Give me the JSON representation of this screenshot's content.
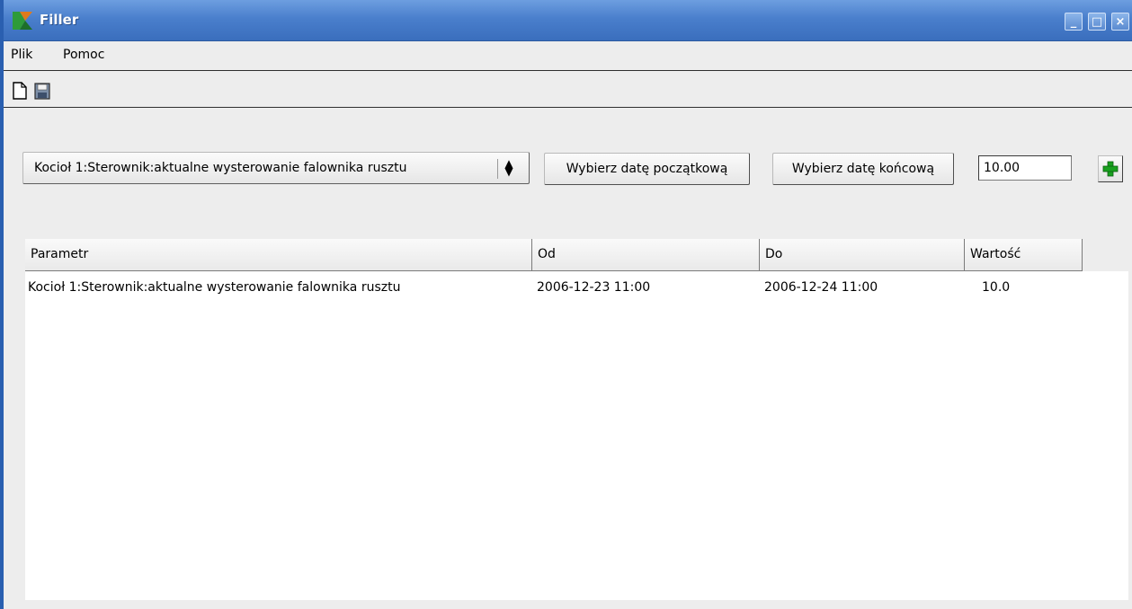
{
  "window": {
    "title": "Filler",
    "controls": [
      "_",
      "□",
      "×"
    ]
  },
  "menu": {
    "items": [
      "Plik",
      "Pomoc"
    ]
  },
  "toolbar": {
    "icons": [
      "new-document-icon",
      "save-icon"
    ]
  },
  "controls": {
    "parameter_select": "Kocioł 1:Sterownik:aktualne wysterowanie falownika rusztu",
    "start_date_button": "Wybierz datę początkową",
    "end_date_button": "Wybierz datę końcową",
    "value_input": "10.00",
    "add_icon": "plus-icon",
    "add_color": "#19a01f"
  },
  "table": {
    "headers": [
      "Parametr",
      "Od",
      "Do",
      "Wartość"
    ],
    "rows": [
      [
        "Kocioł 1:Sterownik:aktualne wysterowanie falownika rusztu",
        "2006-12-23 11:00",
        "2006-12-24 11:00",
        "10.0"
      ]
    ]
  },
  "colors": {
    "titlebar": "#4a7fcc",
    "window_bg": "#ededed"
  }
}
